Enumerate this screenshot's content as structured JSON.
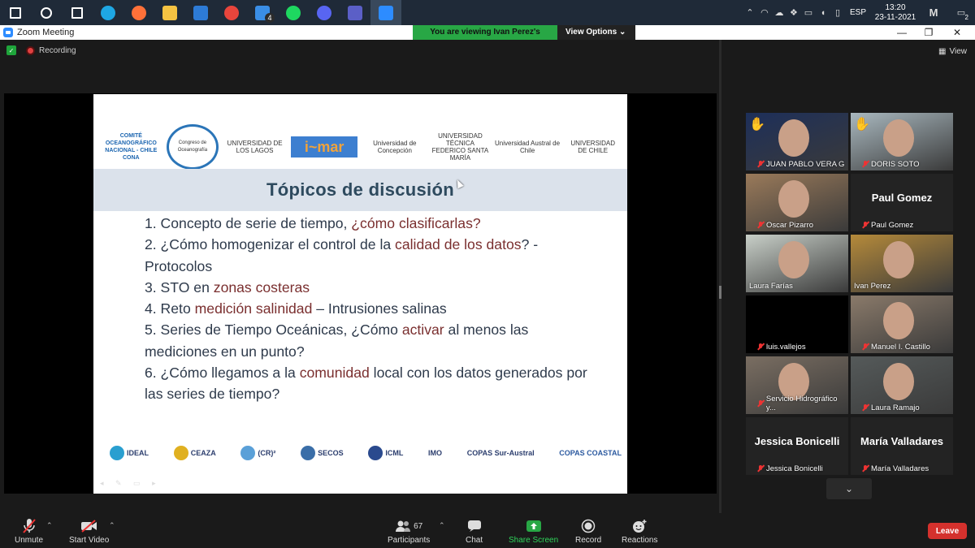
{
  "taskbar": {
    "apps": [
      {
        "name": "windows-start",
        "color": "#ffffff"
      },
      {
        "name": "search",
        "color": "#ffffff"
      },
      {
        "name": "task-view",
        "color": "#ffffff"
      },
      {
        "name": "edge",
        "color": "#1ea7e4"
      },
      {
        "name": "firefox",
        "color": "#ff7139"
      },
      {
        "name": "file-explorer",
        "color": "#f5c342"
      },
      {
        "name": "mail",
        "color": "#2d7bd6"
      },
      {
        "name": "chrome",
        "color": "#e8453c"
      },
      {
        "name": "tasks",
        "color": "#3a8ee6",
        "badge": "4"
      },
      {
        "name": "spotify",
        "color": "#1ed760"
      },
      {
        "name": "discord",
        "color": "#5865f2"
      },
      {
        "name": "teams",
        "color": "#5b5fc7"
      },
      {
        "name": "zoom",
        "color": "#2d8cff"
      }
    ],
    "lang": "ESP",
    "time": "13:20",
    "date": "23-11-2021",
    "notif_count": "2"
  },
  "titlebar": {
    "title": "Zoom Meeting",
    "viewing_banner": "You are viewing Ivan Perez's screen",
    "view_options": "View Options"
  },
  "meeting": {
    "recording": "Recording",
    "view_label": "View"
  },
  "slide": {
    "title": "Tópicos de discusión",
    "top_logos": [
      "COMITÉ OCEANOGRÁFICO NACIONAL - CHILE CONA",
      "Congreso de Oceanografía",
      "UNIVERSIDAD DE LOS LAGOS",
      "i~mar",
      "Universidad de Concepción",
      "UNIVERSIDAD TÉCNICA FEDERICO SANTA MARÍA",
      "Universidad Austral de Chile",
      "UNIVERSIDAD DE CHILE"
    ],
    "bottom_logos": [
      "IDEAL",
      "CEAZA",
      "(CR)²",
      "SECOS",
      "ICML",
      "IMO",
      "COPAS Sur-Austral",
      "COPAS COASTAL"
    ],
    "topics": [
      [
        {
          "t": "1. Concepto de serie de tiempo, "
        },
        {
          "t": "¿cómo clasificarlas?",
          "hl": true
        }
      ],
      [
        {
          "t": "2. ¿Cómo homogenizar el control de la "
        },
        {
          "t": "calidad de los datos",
          "hl": true
        },
        {
          "t": "? - Protocolos"
        }
      ],
      [
        {
          "t": "3. STO en "
        },
        {
          "t": "zonas costeras",
          "hl": true
        }
      ],
      [
        {
          "t": "4. Reto "
        },
        {
          "t": "medición salinidad",
          "hl": true
        },
        {
          "t": " – Intrusiones salinas"
        }
      ],
      [
        {
          "t": "5. Series de Tiempo Oceánicas, ¿Cómo "
        },
        {
          "t": "activar",
          "hl": true
        },
        {
          "t": " al menos las mediciones en un punto?"
        }
      ],
      [
        {
          "t": "6. ¿Cómo llegamos a la "
        },
        {
          "t": "comunidad",
          "hl": true
        },
        {
          "t": " local con los datos generados por las series de tiempo?"
        }
      ]
    ]
  },
  "participants_gallery": [
    {
      "name": "JUAN PABLO VERA G",
      "hand": true,
      "muted": true,
      "video": true,
      "bg": "#1d2f5a"
    },
    {
      "name": "DORIS SOTO",
      "hand": true,
      "muted": true,
      "video": true,
      "bg": "#a9b8bf"
    },
    {
      "name": "Oscar Pizarro",
      "hand": false,
      "muted": true,
      "video": true,
      "bg": "#9a7a5a"
    },
    {
      "name": "Paul Gomez",
      "hand": false,
      "muted": true,
      "video": false,
      "big": "Paul Gomez"
    },
    {
      "name": "Laura Farías",
      "hand": false,
      "muted": false,
      "video": true,
      "speaking": true,
      "bg": "#c8cfc8"
    },
    {
      "name": "Ivan Perez",
      "hand": false,
      "muted": false,
      "video": true,
      "bg": "#b58a3a"
    },
    {
      "name": "luis.vallejos",
      "hand": false,
      "muted": true,
      "video": false,
      "big": ""
    },
    {
      "name": "Manuel I. Castillo",
      "hand": false,
      "muted": true,
      "video": true,
      "bg": "#8a7a6a"
    },
    {
      "name": "Servicio Hidrográfico y...",
      "hand": false,
      "muted": true,
      "video": true,
      "bg": "#7a6e62"
    },
    {
      "name": "Laura Ramajo",
      "hand": false,
      "muted": true,
      "video": true,
      "bg": "#555a5a"
    },
    {
      "name": "Jessica Bonicelli",
      "hand": false,
      "muted": true,
      "video": false,
      "big": "Jessica Bonicelli"
    },
    {
      "name": "María Valladares",
      "hand": false,
      "muted": true,
      "video": false,
      "big": "María Valladares"
    }
  ],
  "toolbar": {
    "unmute": "Unmute",
    "start_video": "Start Video",
    "participants_count": "67",
    "participants": "Participants",
    "chat": "Chat",
    "share_screen": "Share Screen",
    "record": "Record",
    "reactions": "Reactions",
    "leave": "Leave"
  },
  "colors": {
    "share_green": "#28a745",
    "leave_red": "#d4312d",
    "speaking_outline": "#c7e53c",
    "topic_highlight": "#7a2f2f"
  }
}
